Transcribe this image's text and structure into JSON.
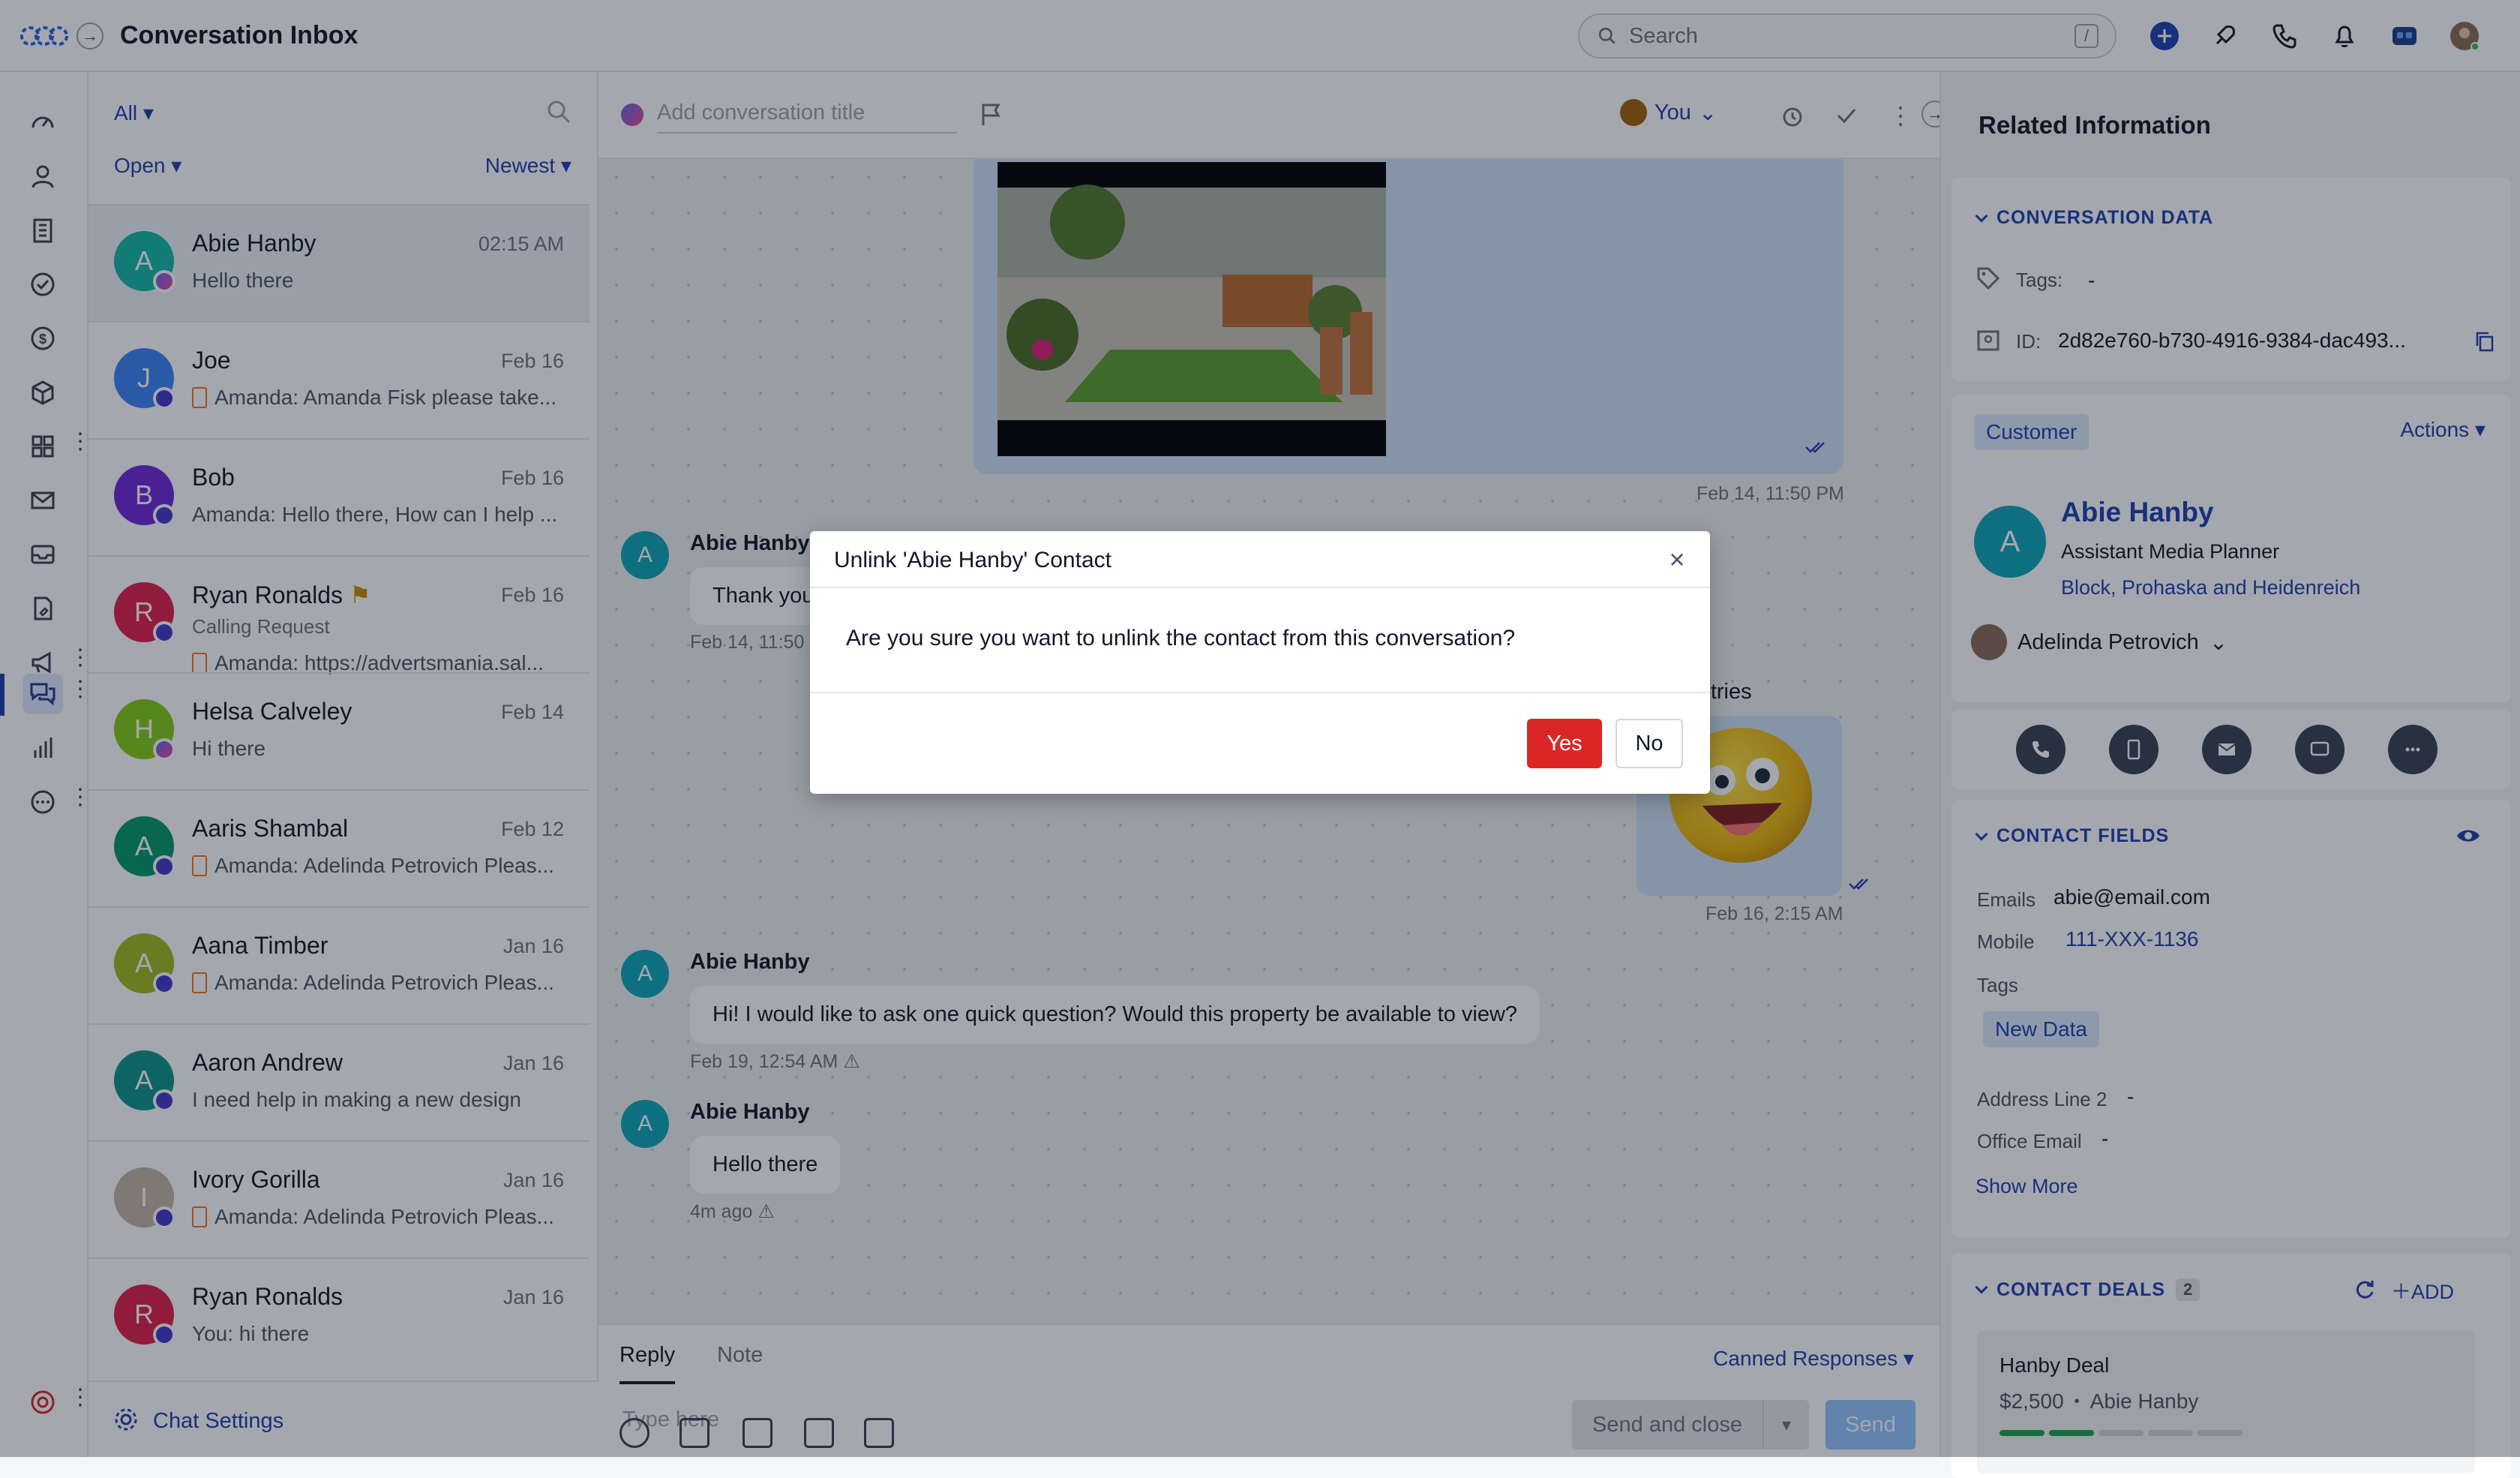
{
  "header": {
    "title": "Conversation Inbox",
    "search_placeholder": "Search",
    "search_shortcut": "/"
  },
  "list": {
    "filter_all": "All",
    "filter_status": "Open",
    "sort": "Newest",
    "conversations": [
      {
        "initial": "A",
        "name": "Abie Hanby",
        "date": "02:15 AM",
        "preview": "Hello there",
        "color": "#14b8a6",
        "channel": "messenger"
      },
      {
        "initial": "J",
        "name": "Joe",
        "date": "Feb 16",
        "preview": "Amanda: Amanda Fisk please take...",
        "color": "#3b82f6",
        "channel": "chat",
        "note": true
      },
      {
        "initial": "B",
        "name": "Bob",
        "date": "Feb 16",
        "preview": "Amanda: Hello there, How can I help ...",
        "color": "#6d28d9",
        "channel": "chat"
      },
      {
        "initial": "R",
        "name": "Ryan Ronalds",
        "date": "Feb 16",
        "subtitle": "Calling Request",
        "preview": "Amanda: https://advertsmania.sal...",
        "color": "#e11d48",
        "channel": "chat",
        "note": true,
        "flag": true
      },
      {
        "initial": "H",
        "name": "Helsa Calveley",
        "date": "Feb 14",
        "preview": "Hi there",
        "color": "#84cc16",
        "channel": "messenger"
      },
      {
        "initial": "A",
        "name": "Aaris Shambal",
        "date": "Feb 12",
        "preview": "Amanda: Adelinda Petrovich Pleas...",
        "color": "#059669",
        "channel": "chat",
        "note": true
      },
      {
        "initial": "A",
        "name": "Aana Timber",
        "date": "Jan 16",
        "preview": "Amanda: Adelinda Petrovich Pleas...",
        "color": "#a3b81d",
        "channel": "chat",
        "note": true
      },
      {
        "initial": "A",
        "name": "Aaron Andrew",
        "date": "Jan 16",
        "preview": "I need help in making a new design",
        "color": "#0d9488",
        "channel": "chat"
      },
      {
        "initial": "I",
        "name": "Ivory Gorilla",
        "date": "Jan 16",
        "preview": "Amanda: Adelinda Petrovich Pleas...",
        "color": "#c4b5a5",
        "channel": "chat",
        "note": true
      },
      {
        "initial": "R",
        "name": "Ryan Ronalds",
        "date": "Jan 16",
        "preview": "You: hi there",
        "color": "#e11d48",
        "channel": "chat"
      }
    ],
    "chat_settings": "Chat Settings"
  },
  "chat": {
    "title_placeholder": "Add conversation title",
    "assignee": "You",
    "messages": {
      "image_time": "Feb 14, 11:50 PM",
      "in1_name": "Abie Hanby",
      "in1_text": "Thank you",
      "in1_time": "Feb 14, 11:50",
      "out2_sender": "ter Industries",
      "out2_time": "Feb 16, 2:15 AM",
      "in2_name": "Abie Hanby",
      "in2_text": "Hi! I would like to ask one quick question? Would this property be available to view?",
      "in2_time": "Feb 19, 12:54 AM",
      "in3_name": "Abie Hanby",
      "in3_text": "Hello there",
      "in3_time": "4m ago"
    },
    "composer": {
      "tab_reply": "Reply",
      "tab_note": "Note",
      "canned": "Canned Responses",
      "placeholder": "Type here",
      "send_close": "Send and close",
      "send": "Send"
    }
  },
  "modal": {
    "title": "Unlink 'Abie Hanby' Contact",
    "body": "Are you sure you want to unlink the contact from this conversation?",
    "yes": "Yes",
    "no": "No"
  },
  "right": {
    "title": "Related Information",
    "conversation_data": "CONVERSATION DATA",
    "tags_label": "Tags:",
    "tags_value": "-",
    "id_label": "ID:",
    "id_value": "2d82e760-b730-4916-9384-dac493...",
    "customer_badge": "Customer",
    "actions": "Actions",
    "contact_name": "Abie Hanby",
    "contact_initial": "A",
    "contact_role": "Assistant Media Planner",
    "contact_company": "Block, Prohaska and Heidenreich",
    "owner": "Adelinda Petrovich",
    "contact_fields": "CONTACT FIELDS",
    "emails_label": "Emails",
    "emails_value": "abie@email.com",
    "mobile_label": "Mobile",
    "mobile_value": "111-XXX-1136",
    "tags2_label": "Tags",
    "tag_pill": "New Data",
    "addr_label": "Address Line 2",
    "addr_value": "-",
    "office_label": "Office Email",
    "office_value": "-",
    "show_more": "Show More",
    "contact_deals": "CONTACT DEALS",
    "deals_count": "2",
    "add": "ADD",
    "deal_name": "Hanby Deal",
    "deal_amount": "$2,500",
    "deal_contact": "Abie Hanby"
  }
}
